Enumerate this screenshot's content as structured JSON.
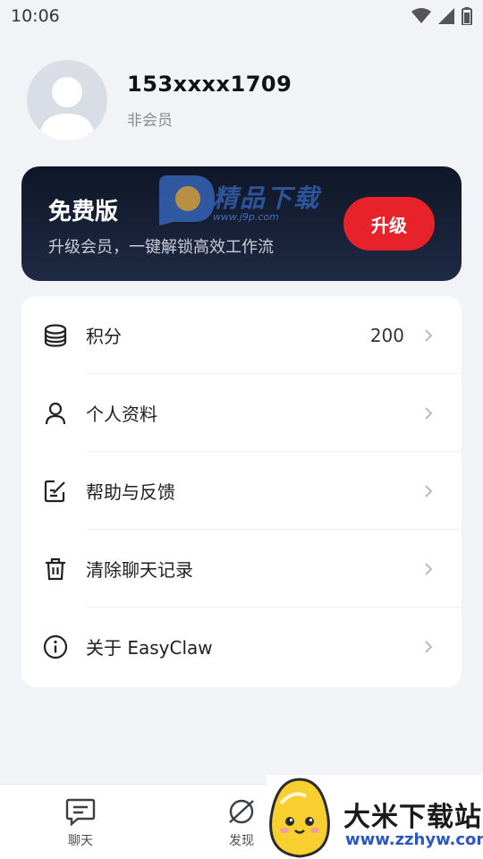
{
  "status_bar": {
    "time": "10:06"
  },
  "profile": {
    "phone": "153xxxx1709",
    "membership": "非会员"
  },
  "vip_card": {
    "title": "免费版",
    "subtitle": "升级会员，一键解锁高效工作流",
    "upgrade_label": "升级",
    "watermark_text": "精品下载",
    "watermark_url": "www.j9p.com"
  },
  "menu": {
    "items": [
      {
        "icon": "database-icon",
        "label": "积分",
        "value": "200"
      },
      {
        "icon": "user-icon",
        "label": "个人资料"
      },
      {
        "icon": "edit-icon",
        "label": "帮助与反馈"
      },
      {
        "icon": "trash-icon",
        "label": "清除聊天记录"
      },
      {
        "icon": "info-icon",
        "label": "关于 EasyClaw"
      }
    ]
  },
  "tabs": [
    {
      "icon": "chat-icon",
      "label": "聊天"
    },
    {
      "icon": "planet-icon",
      "label": "发现"
    }
  ],
  "ad": {
    "title": "大米下载站",
    "url": "www.zzhyw.com"
  },
  "colors": {
    "accent_red": "#e8222a",
    "card_dark": "#1f2a44",
    "background": "#f2f3f7"
  }
}
